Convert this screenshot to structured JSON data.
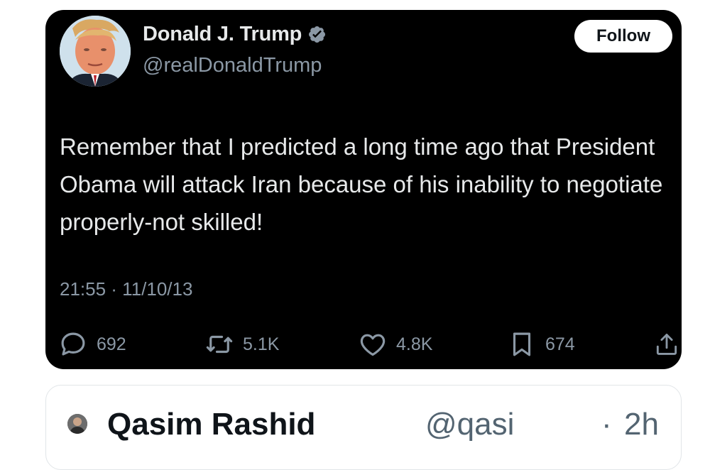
{
  "tweet": {
    "author": {
      "display_name": "Donald J. Trump",
      "handle": "@realDonaldTrump",
      "verified_icon": "verified-badge-icon",
      "avatar": "profile-photo"
    },
    "follow_label": "Follow",
    "text": "Remember that I predicted a long time ago that President Obama will attack Iran because of his inability to negotiate properly-not skilled!",
    "timestamp": "21:55 · 11/10/13",
    "actions": {
      "replies": {
        "icon": "reply-icon",
        "count": "692"
      },
      "reposts": {
        "icon": "repost-icon",
        "count": "5.1K"
      },
      "likes": {
        "icon": "heart-icon",
        "count": "4.8K"
      },
      "bookmarks": {
        "icon": "bookmark-icon",
        "count": "674"
      },
      "share": {
        "icon": "share-icon"
      }
    },
    "colors": {
      "card_background": "#000000",
      "text_primary": "#e7e9ea",
      "text_secondary": "#8b98a5",
      "verified": "#8b98a5",
      "follow_button": "#ffffff"
    }
  },
  "next_post": {
    "display_name": "Qasim Rashid",
    "handle": "@qasi",
    "separator": "·",
    "time": "2h"
  }
}
